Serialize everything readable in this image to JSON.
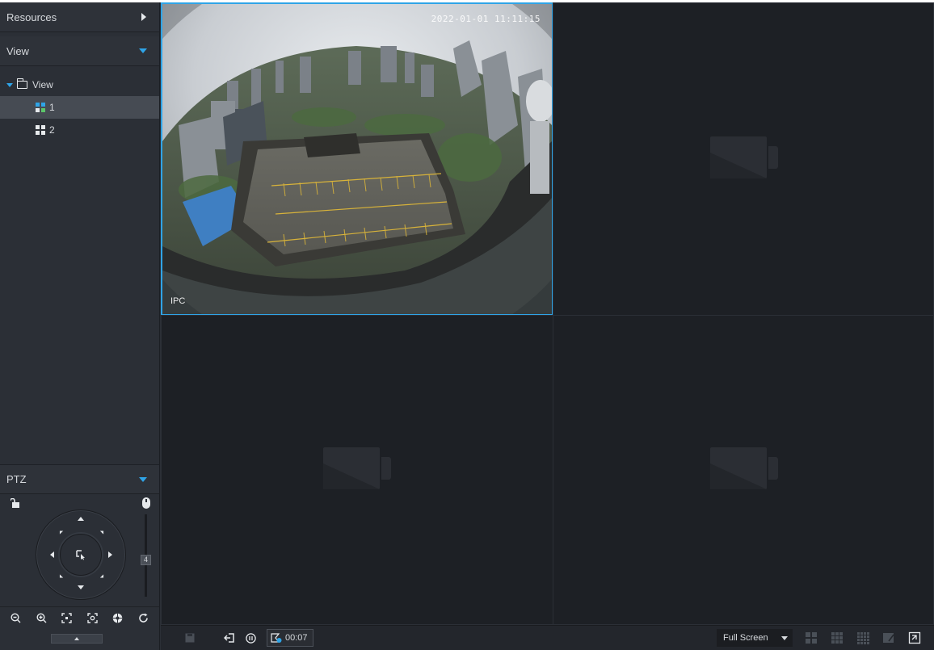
{
  "sidebar": {
    "resources_label": "Resources",
    "view_label": "View",
    "tree": {
      "root_label": "View",
      "items": [
        {
          "label": "1",
          "selected": true
        },
        {
          "label": "2",
          "selected": false
        }
      ]
    },
    "ptz": {
      "title": "PTZ",
      "speed_value": "4",
      "tools": [
        "zoom-out-icon",
        "zoom-in-icon",
        "focus-near-icon",
        "focus-far-icon",
        "iris-icon",
        "refresh-icon"
      ]
    }
  },
  "video": {
    "cell1": {
      "timestamp": "2022-01-01 11:11:15",
      "channel_name": "IPC"
    }
  },
  "toolbar": {
    "timer": "00:07",
    "fullscreen_label": "Full Screen"
  },
  "colors": {
    "accent": "#2fa4e7",
    "panel": "#2b2f36",
    "video_bg": "#1d2025"
  }
}
